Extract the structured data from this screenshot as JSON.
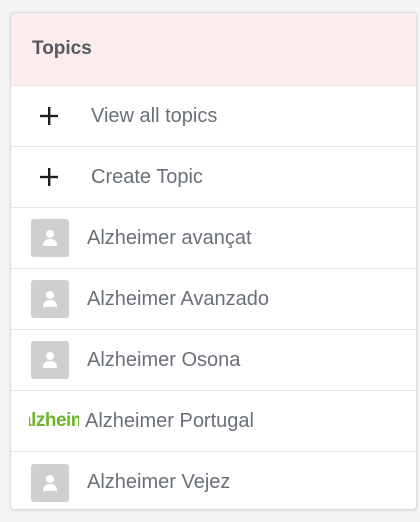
{
  "panel": {
    "title": "Topics"
  },
  "actions": [
    {
      "label": "View all topics",
      "icon": "plus-icon"
    },
    {
      "label": "Create Topic",
      "icon": "plus-icon"
    }
  ],
  "topics": [
    {
      "label": "Alzheimer avançat",
      "icon": "user-avatar-icon"
    },
    {
      "label": "Alzheimer Avanzado",
      "icon": "user-avatar-icon"
    },
    {
      "label": "Alzheimer Osona",
      "icon": "user-avatar-icon"
    },
    {
      "label": "Alzheimer Portugal",
      "icon": "alzheimer-portugal-logo",
      "logo_text": "alzheimer"
    },
    {
      "label": "Alzheimer Vejez",
      "icon": "user-avatar-icon"
    }
  ],
  "colors": {
    "header_bg": "#fcecec",
    "logo_green": "#6cb52d",
    "avatar_bg": "#cfcfcf"
  }
}
